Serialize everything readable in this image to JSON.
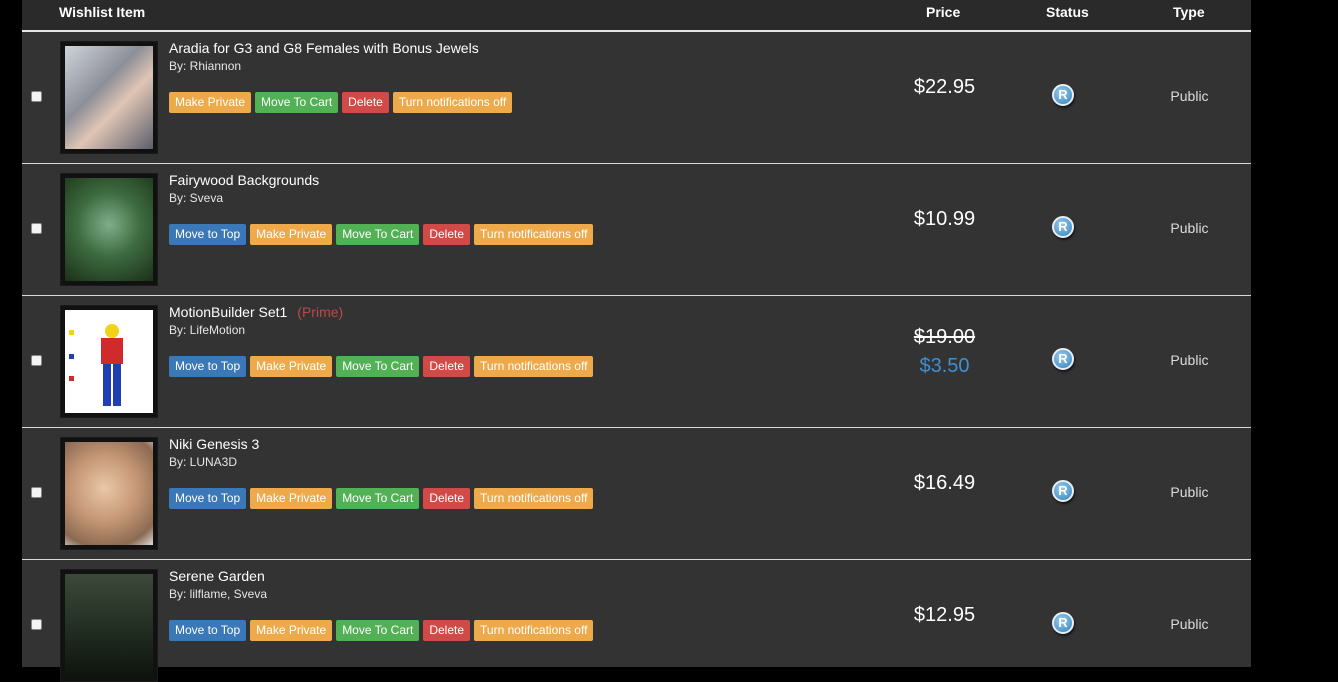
{
  "header": {
    "item_label": "Wishlist Item",
    "price_label": "Price",
    "status_label": "Status",
    "type_label": "Type"
  },
  "colors": {
    "background": "#000000",
    "panel": "#2f2f2f",
    "move_to_top": "#3a78b8",
    "make_private": "#eeaa4a",
    "move_to_cart": "#52b055",
    "delete": "#d24a47",
    "notifications": "#eeaa4a",
    "prime": "#b94a48",
    "sale_price": "#3e8fd6"
  },
  "buttons": {
    "move_to_top": "Move to Top",
    "make_private": "Make Private",
    "move_to_cart": "Move To Cart",
    "delete": "Delete",
    "notifications": "Turn notifications off"
  },
  "items": [
    {
      "title": "Aradia for G3 and G8 Females with Bonus Jewels",
      "by": "By: Rhiannon",
      "thumb_icon": "aradia-thumbnail",
      "price": "$22.95",
      "status_icon": "registered-icon",
      "status_glyph": "R",
      "type": "Public"
    },
    {
      "title": "Fairywood Backgrounds",
      "by": "By: Sveva",
      "thumb_icon": "fairywood-thumbnail",
      "price": "$10.99",
      "status_icon": "registered-icon",
      "status_glyph": "R",
      "type": "Public"
    },
    {
      "title": "MotionBuilder Set1",
      "prime": "(Prime)",
      "by": "By: LifeMotion",
      "thumb_icon": "motionbuilder-thumbnail",
      "price_old": "$19.00",
      "price_new": "$3.50",
      "status_icon": "registered-icon",
      "status_glyph": "R",
      "type": "Public"
    },
    {
      "title": "Niki Genesis 3",
      "by": "By: LUNA3D",
      "thumb_icon": "niki-thumbnail",
      "price": "$16.49",
      "status_icon": "registered-icon",
      "status_glyph": "R",
      "type": "Public"
    },
    {
      "title": "Serene Garden",
      "by": "By: lilflame, Sveva",
      "thumb_icon": "serene-garden-thumbnail",
      "price": "$12.95",
      "status_icon": "registered-icon",
      "status_glyph": "R",
      "type": "Public"
    }
  ]
}
